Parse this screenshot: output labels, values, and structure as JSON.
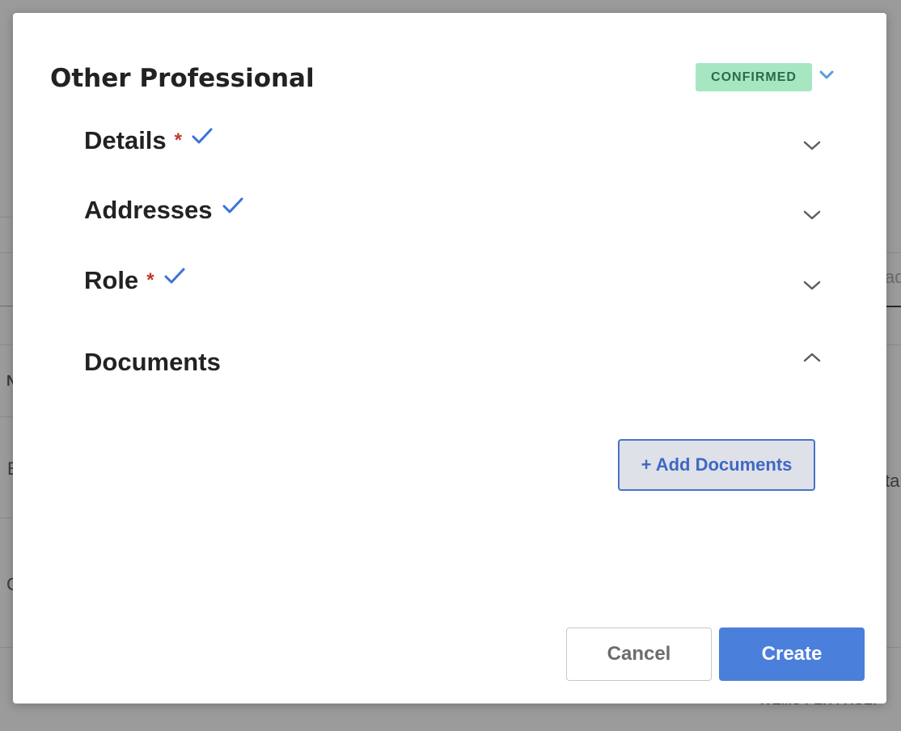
{
  "backdrop": {
    "fragments": [
      "ad",
      "N",
      "E",
      "ta",
      "C"
    ],
    "footer_label": "ITEMS PER PAGE:"
  },
  "modal": {
    "title": "Other Professional",
    "status": {
      "label": "CONFIRMED",
      "bg_color": "#a6e7c2",
      "text_color": "#2d6a45"
    },
    "sections": [
      {
        "label": "Details",
        "required": true,
        "completed": true,
        "expanded": false,
        "chevron_icon": "chevron-down-icon"
      },
      {
        "label": "Addresses",
        "required": false,
        "completed": true,
        "expanded": false,
        "chevron_icon": "chevron-down-icon"
      },
      {
        "label": "Role",
        "required": true,
        "completed": true,
        "expanded": false,
        "chevron_icon": "chevron-down-icon"
      },
      {
        "label": "Documents",
        "required": false,
        "completed": false,
        "expanded": true,
        "chevron_icon": "chevron-up-icon"
      }
    ],
    "required_marker": "*",
    "documents": {
      "add_button_label": "+ Add Documents"
    },
    "footer": {
      "cancel_label": "Cancel",
      "create_label": "Create"
    }
  },
  "colors": {
    "accent": "#4a7fdc",
    "check": "#3a73d8",
    "required": "#c0392b"
  }
}
